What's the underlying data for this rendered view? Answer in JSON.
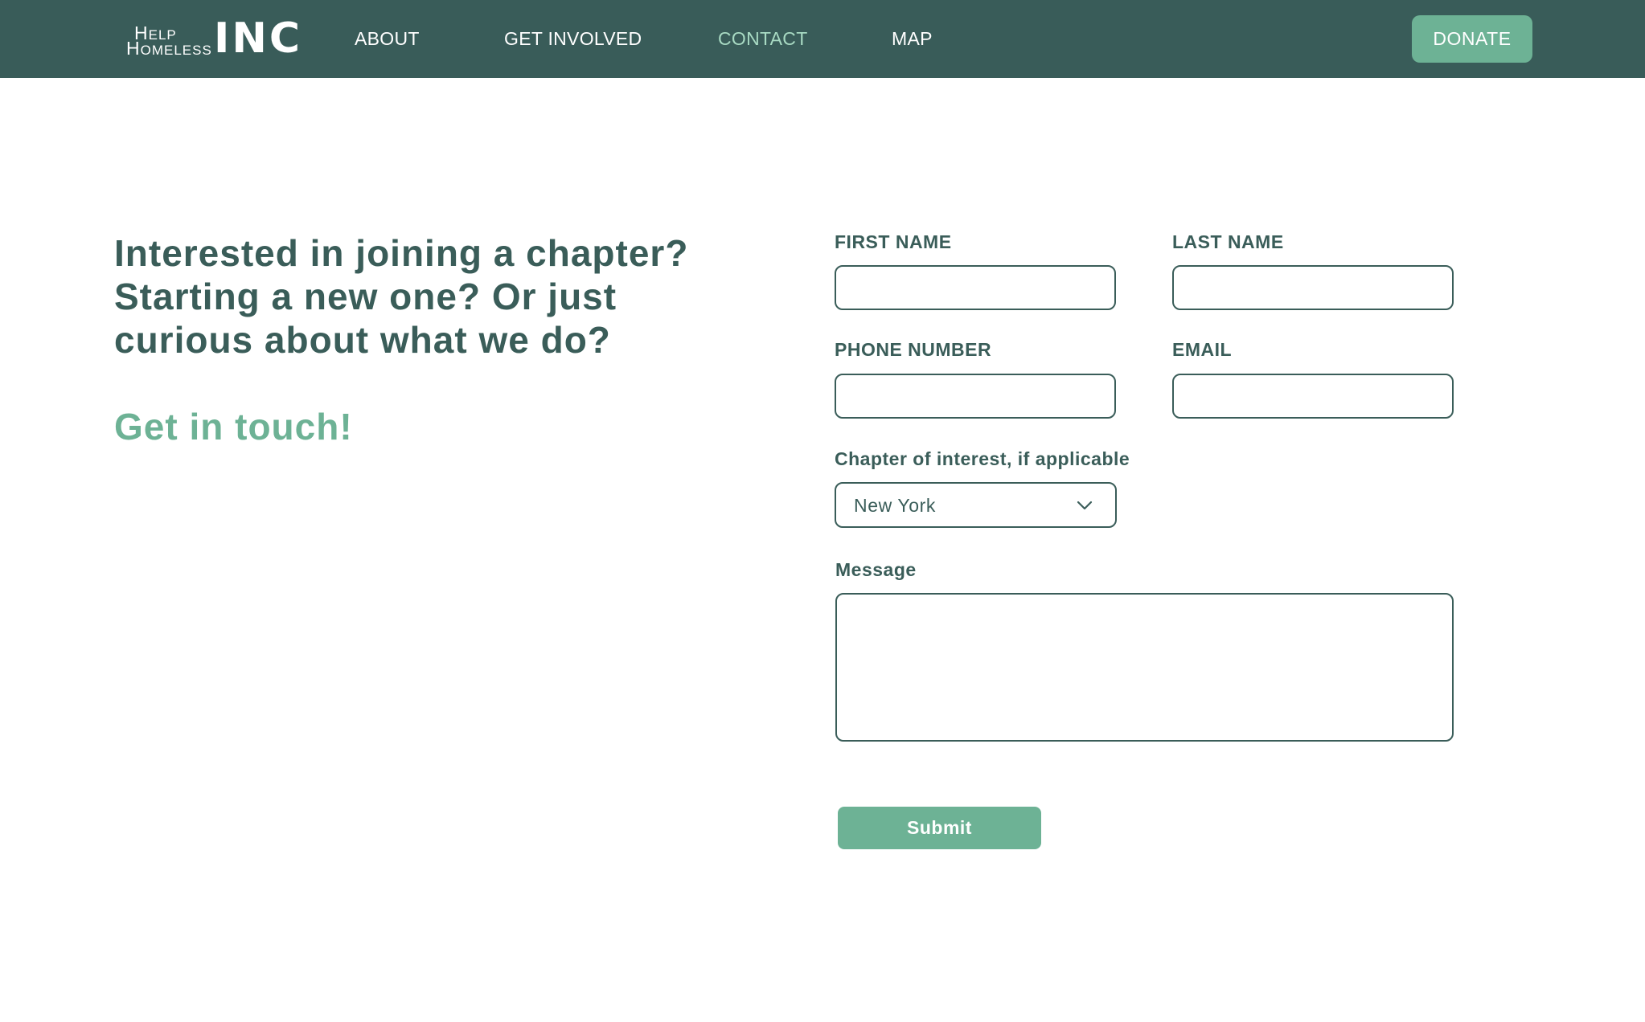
{
  "header": {
    "logo": {
      "line1_cap": "H",
      "line1_rest": "ELP",
      "line2_cap": "H",
      "line2_rest": "OMELESS",
      "big": "INC"
    },
    "nav": [
      {
        "label": "ABOUT",
        "active": false
      },
      {
        "label": "GET INVOLVED",
        "active": false
      },
      {
        "label": "CONTACT",
        "active": true
      },
      {
        "label": "MAP",
        "active": false
      }
    ],
    "donate_label": "DONATE"
  },
  "intro": {
    "headline_lines": [
      "Interested in joining a chapter?",
      "Starting a new one? Or just",
      "curious about what we do?"
    ],
    "cta": "Get in touch!"
  },
  "form": {
    "first_name": {
      "label": "FIRST NAME",
      "value": ""
    },
    "last_name": {
      "label": "LAST NAME",
      "value": ""
    },
    "phone": {
      "label": "PHONE NUMBER",
      "value": ""
    },
    "email": {
      "label": "EMAIL",
      "value": ""
    },
    "chapter": {
      "label": "Chapter of interest, if applicable",
      "selected": "New York"
    },
    "message": {
      "label": "Message",
      "value": ""
    },
    "submit_label": "Submit"
  },
  "colors": {
    "nav_bg": "#395c59",
    "accent": "#6db295",
    "active_nav": "#a8dac3",
    "text": "#3a5d59"
  },
  "icons": {
    "select_arrow": "chevron-down-icon"
  }
}
